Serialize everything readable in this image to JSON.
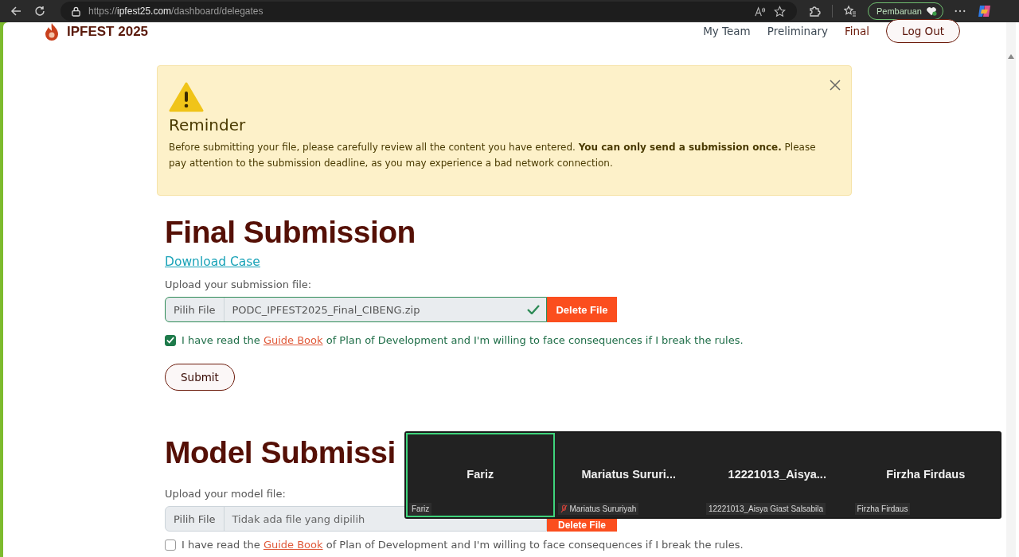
{
  "browser": {
    "url": {
      "scheme": "https://",
      "host": "ipfest25.com",
      "path": "/dashboard/delegates"
    },
    "update_button": "Pembaruan"
  },
  "site": {
    "logo_text": "IPFEST 2025",
    "nav": [
      {
        "label": "My Team",
        "selected": false
      },
      {
        "label": "Preliminary",
        "selected": false
      },
      {
        "label": "Final",
        "selected": true
      }
    ],
    "logout": "Log Out"
  },
  "alert": {
    "title": "Reminder",
    "text": "Before submitting your file, please carefully review all the content you have entered. **You can only send a submission once.** Please pay attention to the submission deadline, as you may experience a bad network connection."
  },
  "sections": [
    {
      "title": "Final Submission",
      "link": "Download Case",
      "upload_label": "Upload your submission file:",
      "file_button": "Pilih File",
      "file_name": "PODC_IPFEST2025_Final_CIBENG.zip",
      "uploaded": true,
      "delete": "Delete File",
      "agree": {
        "checked": true,
        "before": "I have read the ",
        "link": "Guide Book",
        "after": " of Plan of Development and I'm willing to face consequences if I break the rules."
      },
      "submit": "Submit"
    },
    {
      "title": "Model Submissi",
      "upload_label": "Upload your model file:",
      "file_button": "Pilih File",
      "file_name": "Tidak ada file yang dipilih",
      "uploaded": false,
      "delete": "Delete File",
      "agree": {
        "checked": false,
        "before": "I have read the ",
        "link": "Guide Book",
        "after": " of Plan of Development and I'm willing to face consequences if I break the rules."
      }
    }
  ],
  "meeting": {
    "participants": [
      {
        "display": "Fariz",
        "label": "Fariz",
        "selected": true,
        "muted": false
      },
      {
        "display": "Mariatus  Sururi...",
        "label": "Mariatus Sururiyah",
        "selected": false,
        "muted": true
      },
      {
        "display": "12221013_Aisya...",
        "label": "12221013_Aisya Giast Salsabila",
        "selected": false,
        "muted": false
      },
      {
        "display": "Firzha Firdaus",
        "label": "Firzha Firdaus",
        "selected": false,
        "muted": false
      }
    ]
  }
}
